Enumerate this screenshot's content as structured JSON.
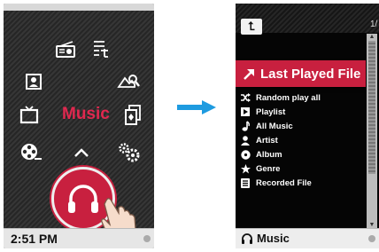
{
  "left_screen": {
    "center_label": "Music",
    "time": "2:51 PM"
  },
  "right_screen": {
    "back_icon_glyph": "⮤",
    "page_indicator": "1/",
    "selected_item": "Last Played File",
    "items": [
      {
        "label": "Random play all",
        "icon": "shuffle-icon"
      },
      {
        "label": "Playlist",
        "icon": "playlist-icon"
      },
      {
        "label": "All Music",
        "icon": "note-icon"
      },
      {
        "label": "Artist",
        "icon": "person-icon"
      },
      {
        "label": "Album",
        "icon": "disc-icon"
      },
      {
        "label": "Genre",
        "icon": "star-icon"
      },
      {
        "label": "Recorded File",
        "icon": "document-icon"
      }
    ],
    "status_label": "Music"
  },
  "colors": {
    "accent": "#c8203f",
    "arrow": "#1e9be0"
  }
}
